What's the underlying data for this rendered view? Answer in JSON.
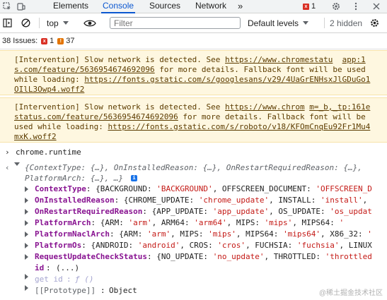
{
  "tabs": {
    "elements": "Elements",
    "console": "Console",
    "sources": "Sources",
    "network": "Network",
    "more": "»"
  },
  "topbar": {
    "error_count": "1"
  },
  "toolbar": {
    "context": "top",
    "filter_placeholder": "Filter",
    "levels": "Default levels",
    "hidden": "2 hidden"
  },
  "issues": {
    "label": "38 Issues:",
    "errors": "1",
    "warnings": "37"
  },
  "warnings": [
    {
      "pre": "[Intervention] Slow network is detected. See ",
      "link": "https://www.chromestatu",
      "src": "app:1",
      "link2": "s.com/feature/5636954674692096",
      "mid": " for more details. Fallback font will be used while loading: ",
      "font_url": "https://fonts.gstatic.com/s/googlesans/v29/4UaGrENHsxJlGDuGo1OIlL3Owp4.woff2"
    },
    {
      "pre": "[Intervention] Slow network is detected. See ",
      "link": "https://www.chrom",
      "src": "m=_b,_tp:161",
      "link2": "estatus.com/feature/5636954674692096",
      "mid": " for more details. Fallback font will be used while loading: ",
      "font_url": "https://fonts.gstatic.com/s/roboto/v18/KFOmCnqEu92Fr1Mu4mxK.woff2"
    }
  ],
  "console": {
    "input": "chrome.runtime",
    "summary1": "{ContextType: {…}, OnInstalledReason: {…}, OnRestartRequiredReason: {…},",
    "summary2": "PlatformArch: {…}, …}",
    "props": [
      {
        "key": "ContextType",
        "value_parts": [
          [
            "{BACKGROUND: ",
            "p"
          ],
          [
            "'BACKGROUND'",
            "s"
          ],
          [
            ", OFFSCREEN_DOCUMENT: ",
            "p"
          ],
          [
            "'OFFSCREEN_D",
            "s"
          ]
        ]
      },
      {
        "key": "OnInstalledReason",
        "value_parts": [
          [
            "{CHROME_UPDATE: ",
            "p"
          ],
          [
            "'chrome_update'",
            "s"
          ],
          [
            ", INSTALL: ",
            "p"
          ],
          [
            "'install'",
            "s"
          ],
          [
            ", ",
            "p"
          ]
        ]
      },
      {
        "key": "OnRestartRequiredReason",
        "value_parts": [
          [
            "{APP_UPDATE: ",
            "p"
          ],
          [
            "'app_update'",
            "s"
          ],
          [
            ", OS_UPDATE: ",
            "p"
          ],
          [
            "'os_updat",
            "s"
          ]
        ]
      },
      {
        "key": "PlatformArch",
        "value_parts": [
          [
            "{ARM: ",
            "p"
          ],
          [
            "'arm'",
            "s"
          ],
          [
            ", ARM64: ",
            "p"
          ],
          [
            "'arm64'",
            "s"
          ],
          [
            ", MIPS: ",
            "p"
          ],
          [
            "'mips'",
            "s"
          ],
          [
            ", MIPS64: ",
            "p"
          ],
          [
            "'",
            "s"
          ]
        ]
      },
      {
        "key": "PlatformNaclArch",
        "value_parts": [
          [
            "{ARM: ",
            "p"
          ],
          [
            "'arm'",
            "s"
          ],
          [
            ", MIPS: ",
            "p"
          ],
          [
            "'mips'",
            "s"
          ],
          [
            ", MIPS64: ",
            "p"
          ],
          [
            "'mips64'",
            "s"
          ],
          [
            ", X86_32: ",
            "p"
          ],
          [
            "'",
            "s"
          ]
        ]
      },
      {
        "key": "PlatformOs",
        "value_parts": [
          [
            "{ANDROID: ",
            "p"
          ],
          [
            "'android'",
            "s"
          ],
          [
            ", CROS: ",
            "p"
          ],
          [
            "'cros'",
            "s"
          ],
          [
            ", FUCHSIA: ",
            "p"
          ],
          [
            "'fuchsia'",
            "s"
          ],
          [
            ", LINUX",
            "p"
          ]
        ]
      },
      {
        "key": "RequestUpdateCheckStatus",
        "value_parts": [
          [
            "{NO_UPDATE: ",
            "p"
          ],
          [
            "'no_update'",
            "s"
          ],
          [
            ", THROTTLED: ",
            "p"
          ],
          [
            "'throttled",
            "s"
          ]
        ]
      }
    ],
    "id_line": {
      "key": "id",
      "value": "(...)"
    },
    "getter_line": {
      "label": "get id",
      "value": "ƒ ()"
    },
    "proto_line": {
      "key": "[[Prototype]]",
      "value": "Object"
    }
  },
  "watermark": "@稀土掘金技术社区"
}
